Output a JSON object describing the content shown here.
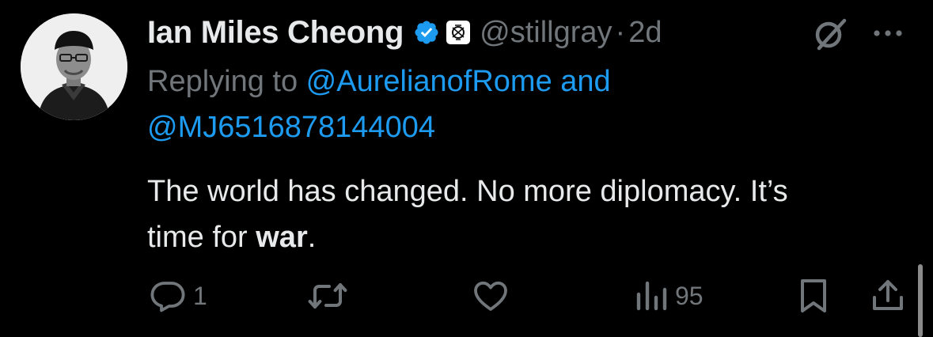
{
  "tweet": {
    "author_name": "Ian Miles Cheong",
    "handle": "@stillgray",
    "separator": "·",
    "time": "2d",
    "replying_prefix": "Replying to ",
    "reply_to_1": "@AurelianofRome",
    "reply_joiner": " and",
    "reply_to_2": "@MJ6516878144004",
    "text_line_1": "The world has changed. No more diplomacy. It’s",
    "text_line_2_prefix": "time for ",
    "text_bold": "war",
    "text_suffix": "."
  },
  "actions": {
    "reply_count": "1",
    "views_count": "95"
  },
  "icons": {
    "verified": "verified-badge-icon",
    "affiliation": "affiliation-badge-icon",
    "grok": "grok-icon",
    "more": "more-options-icon",
    "reply": "reply-icon",
    "retweet": "retweet-icon",
    "like": "like-icon",
    "views": "views-icon",
    "bookmark": "bookmark-icon",
    "share": "share-icon"
  },
  "colors": {
    "background": "#000000",
    "primary_text": "#e7e9ea",
    "secondary_text": "#71767b",
    "link": "#1d9bf0",
    "verified_badge": "#1d9bf0"
  }
}
